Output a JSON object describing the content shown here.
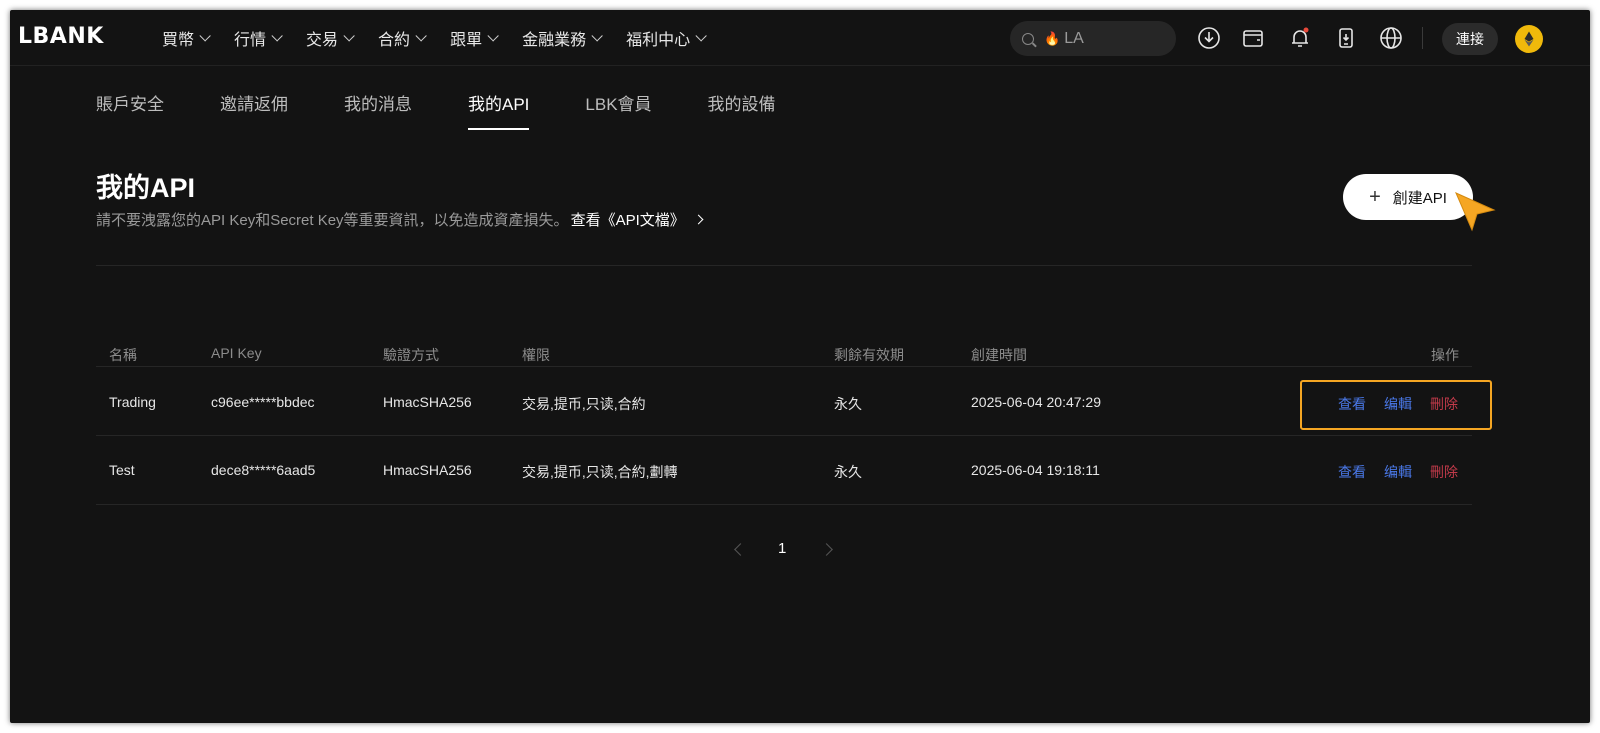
{
  "nav": {
    "logo": "LBANK",
    "menu": [
      {
        "label": "買幣"
      },
      {
        "label": "行情"
      },
      {
        "label": "交易"
      },
      {
        "label": "合約"
      },
      {
        "label": "跟單"
      },
      {
        "label": "金融業務"
      },
      {
        "label": "福利中心"
      }
    ],
    "search_query": "LA",
    "connect_label": "連接"
  },
  "tabs": [
    {
      "label": "賬戶安全"
    },
    {
      "label": "邀請返佣"
    },
    {
      "label": "我的消息"
    },
    {
      "label": "我的API",
      "active": true
    },
    {
      "label": "LBK會員"
    },
    {
      "label": "我的設備"
    }
  ],
  "header": {
    "title": "我的API",
    "subtitle": "請不要洩露您的API Key和Secret Key等重要資訊，以免造成資產損失。",
    "doc_link": "查看《API文檔》",
    "create_label": "創建API"
  },
  "table": {
    "columns": [
      "名稱",
      "API Key",
      "驗證方式",
      "權限",
      "剩餘有效期",
      "創建時間",
      "操作"
    ],
    "rows": [
      {
        "name": "Trading",
        "api_key": "c96ee*****bbdec",
        "auth": "HmacSHA256",
        "perm": "交易,提币,只读,合約",
        "validity": "永久",
        "created": "2025-06-04 20:47:29"
      },
      {
        "name": "Test",
        "api_key": "dece8*****6aad5",
        "auth": "HmacSHA256",
        "perm": "交易,提币,只读,合約,劃轉",
        "validity": "永久",
        "created": "2025-06-04 19:18:11"
      }
    ],
    "actions": {
      "view": "查看",
      "edit": "编輯",
      "delete": "刪除"
    }
  },
  "pagination": {
    "current": "1"
  },
  "colors": {
    "accent": "#f5a623",
    "link_blue": "#4a78e8",
    "danger": "#c23a4a",
    "background": "#131313"
  }
}
